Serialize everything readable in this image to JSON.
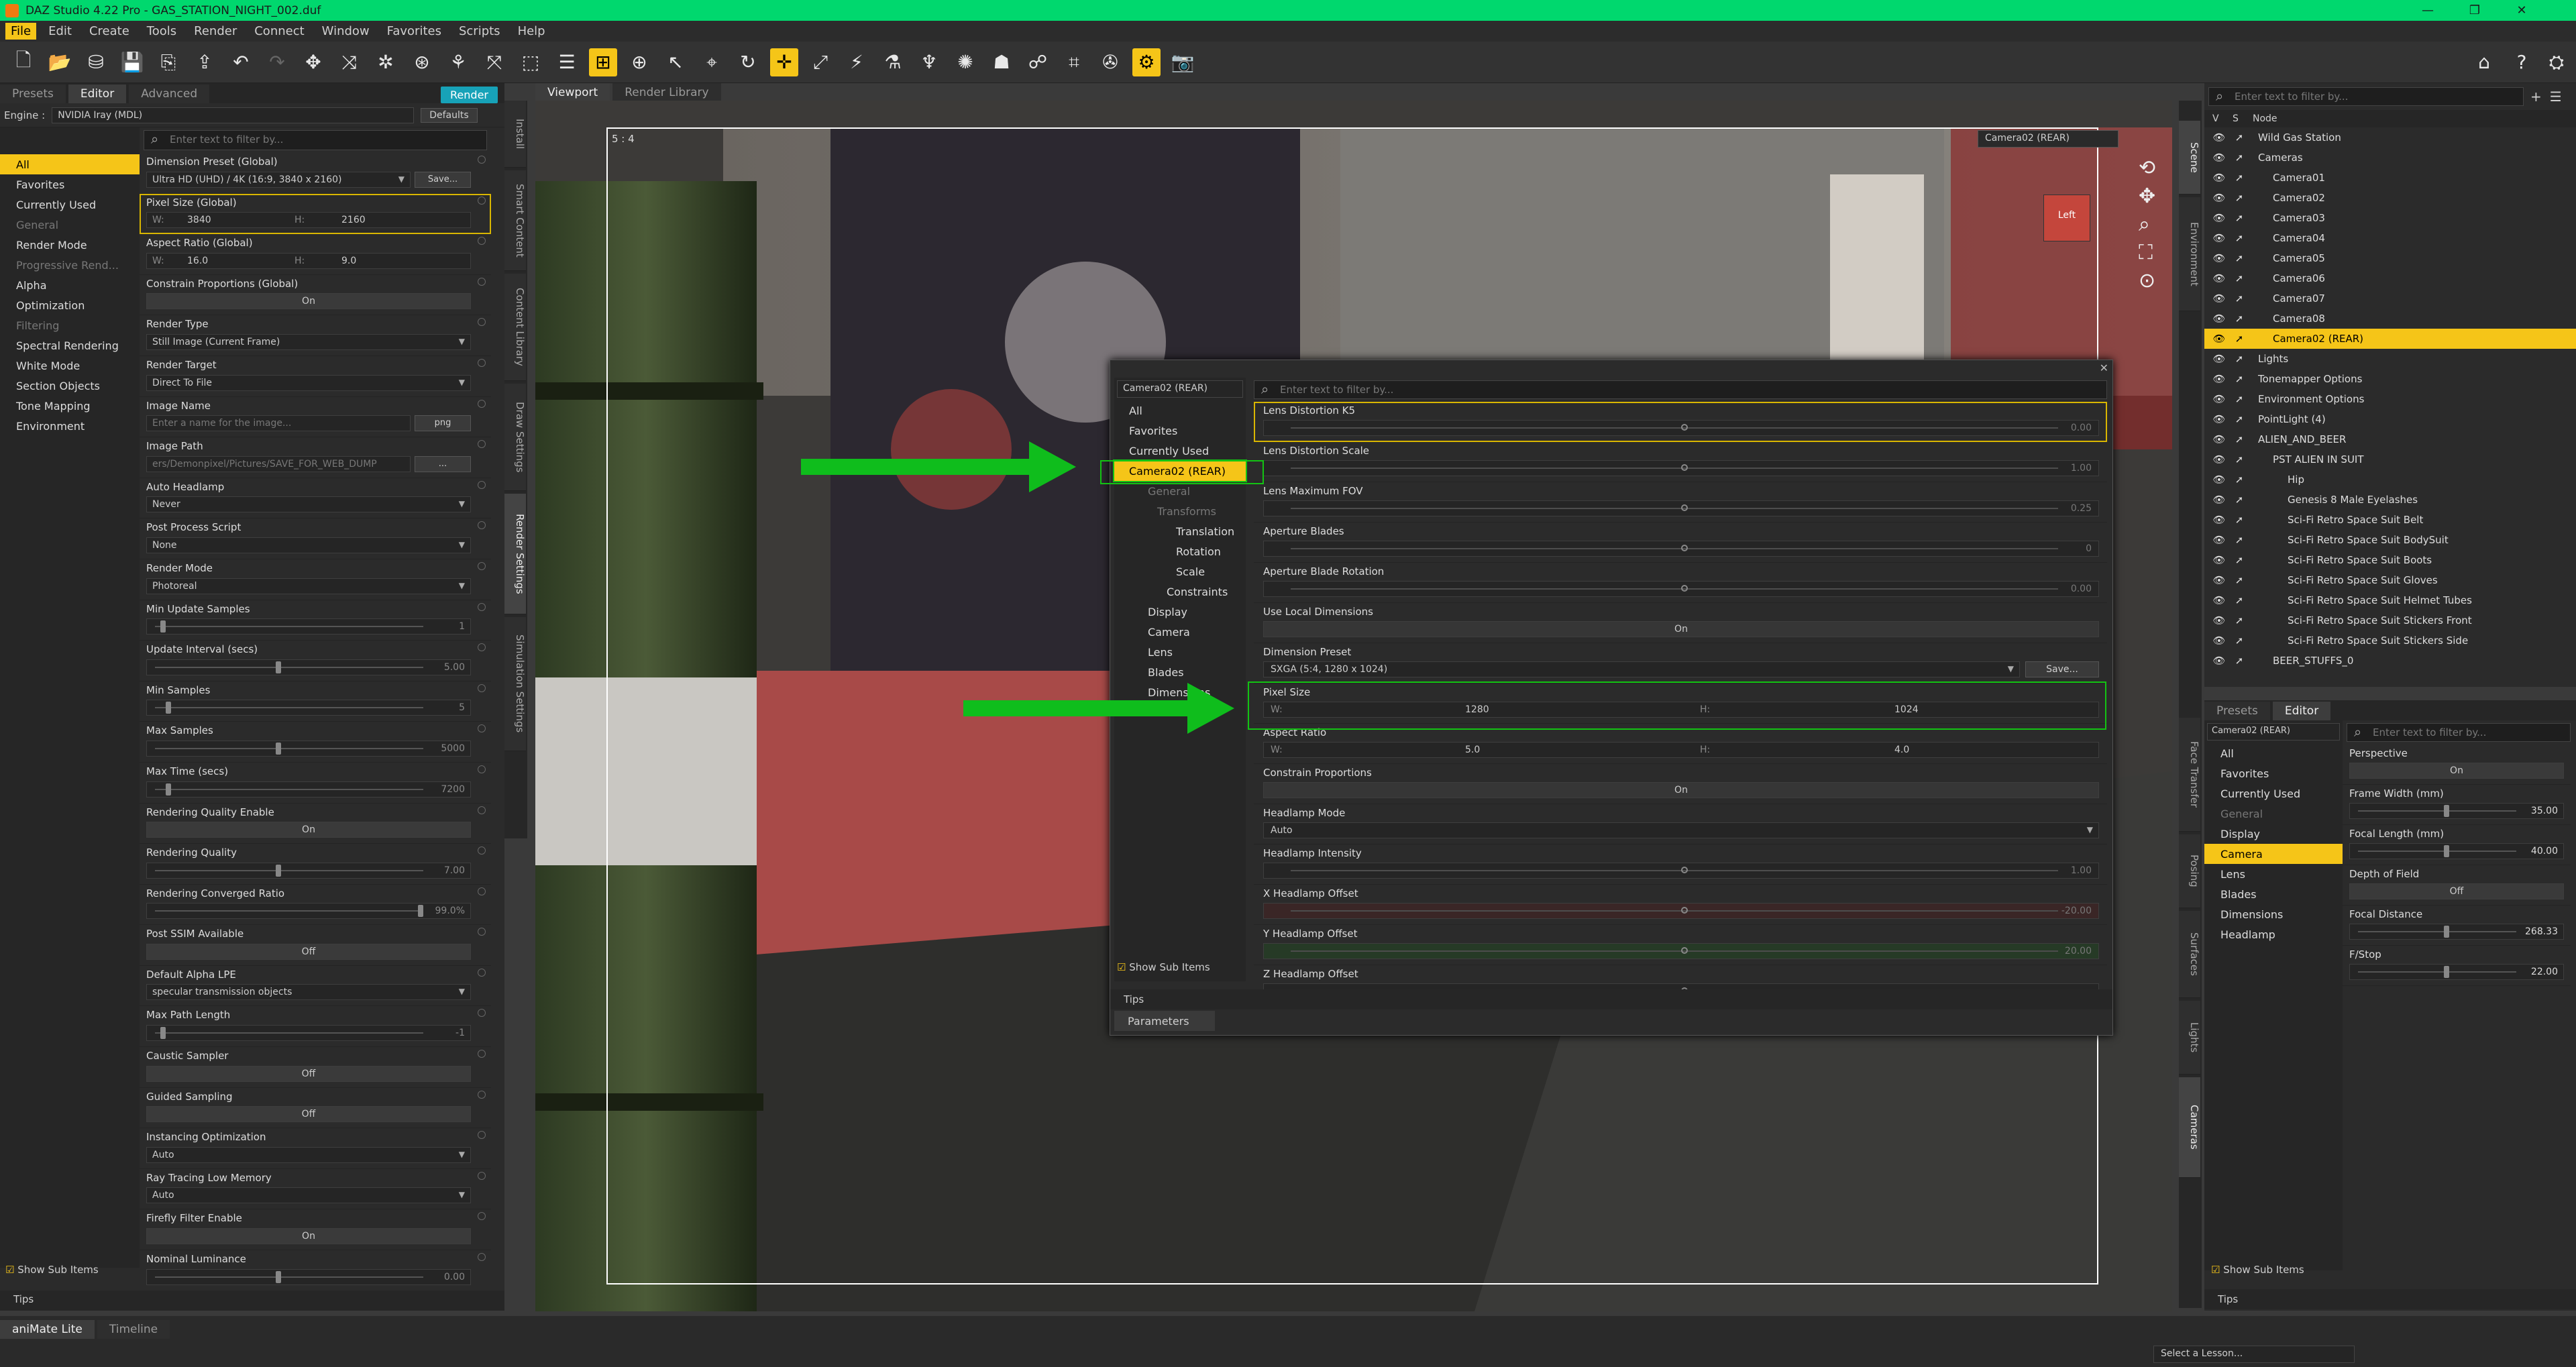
{
  "window": {
    "title": "DAZ Studio 4.22 Pro - GAS_STATION_NIGHT_002.duf",
    "min": "—",
    "max": "❐",
    "close": "✕"
  },
  "menus": [
    "File",
    "Edit",
    "Create",
    "Tools",
    "Render",
    "Connect",
    "Window",
    "Favorites",
    "Scripts",
    "Help"
  ],
  "left_panel": {
    "tabs": [
      "Presets",
      "Editor",
      "Advanced"
    ],
    "render_button": "Render",
    "engine_label": "Engine :",
    "engine_value": "NVIDIA Iray (MDL)",
    "defaults": "Defaults",
    "search_placeholder": "Enter text to filter by...",
    "nav": [
      "All",
      "Favorites",
      "Currently Used",
      "General",
      "Render Mode",
      "Progressive Rend...",
      "Alpha",
      "Optimization",
      "Filtering",
      "Spectral Rendering",
      "White Mode",
      "Section Objects",
      "Tone Mapping",
      "Environment"
    ],
    "props": [
      {
        "label": "Dimension Preset (Global)",
        "kind": "drop",
        "value": "Ultra HD (UHD) / 4K (16:9, 3840 x 2160)",
        "extra": "Save..."
      },
      {
        "label": "Pixel Size (Global)",
        "kind": "wh",
        "w": "3840",
        "h": "2160",
        "hi": true
      },
      {
        "label": "Aspect Ratio (Global)",
        "kind": "wh",
        "w": "16.0",
        "h": "9.0"
      },
      {
        "label": "Constrain Proportions (Global)",
        "kind": "btn",
        "value": "On"
      },
      {
        "label": "Render Type",
        "kind": "drop",
        "value": "Still Image (Current Frame)"
      },
      {
        "label": "Render Target",
        "kind": "drop",
        "value": "Direct To File"
      },
      {
        "label": "Image Name",
        "kind": "text",
        "value": "Enter a name for the image...",
        "extra": "png"
      },
      {
        "label": "Image Path",
        "kind": "text",
        "value": "ers/Demonpixel/Pictures/SAVE_FOR_WEB_DUMP",
        "extra": "..."
      },
      {
        "label": "Auto Headlamp",
        "kind": "drop",
        "value": "Never"
      },
      {
        "label": "Post Process Script",
        "kind": "drop",
        "value": "None"
      },
      {
        "label": "Render Mode",
        "kind": "drop",
        "value": "Photoreal"
      },
      {
        "label": "Min Update Samples",
        "kind": "slider",
        "value": "1",
        "pos": 0.02
      },
      {
        "label": "Update Interval (secs)",
        "kind": "slider",
        "value": "5.00",
        "pos": 0.45
      },
      {
        "label": "Min Samples",
        "kind": "slider",
        "value": "5",
        "pos": 0.04
      },
      {
        "label": "Max Samples",
        "kind": "slider",
        "value": "5000",
        "pos": 0.45
      },
      {
        "label": "Max Time (secs)",
        "kind": "slider",
        "value": "7200",
        "pos": 0.04
      },
      {
        "label": "Rendering Quality Enable",
        "kind": "btn",
        "value": "On"
      },
      {
        "label": "Rendering Quality",
        "kind": "slider",
        "value": "7.00",
        "pos": 0.45
      },
      {
        "label": "Rendering Converged Ratio",
        "kind": "slider",
        "value": "99.0%",
        "pos": 0.98
      },
      {
        "label": "Post SSIM Available",
        "kind": "btn",
        "value": "Off"
      },
      {
        "label": "Default Alpha LPE",
        "kind": "drop",
        "value": "specular transmission objects"
      },
      {
        "label": "Max Path Length",
        "kind": "slider",
        "value": "-1",
        "pos": 0.02
      },
      {
        "label": "Caustic Sampler",
        "kind": "btn",
        "value": "Off"
      },
      {
        "label": "Guided Sampling",
        "kind": "btn",
        "value": "Off"
      },
      {
        "label": "Instancing Optimization",
        "kind": "drop",
        "value": "Auto"
      },
      {
        "label": "Ray Tracing Low Memory",
        "kind": "drop",
        "value": "Auto"
      },
      {
        "label": "Firefly Filter Enable",
        "kind": "btn",
        "value": "On"
      },
      {
        "label": "Nominal Luminance",
        "kind": "slider",
        "value": "0.00",
        "pos": 0.45
      }
    ],
    "show_sub": "Show Sub Items",
    "tips": "Tips"
  },
  "left_vtabs": [
    "Install",
    "Smart Content",
    "Content Library",
    "Draw Settings",
    "Render Settings",
    "Simulation Settings"
  ],
  "viewport": {
    "tabs": [
      "Viewport",
      "Render Library"
    ],
    "ratio": "5 : 4",
    "camera": "Camera02 (REAR)",
    "cube": "Left"
  },
  "floating": {
    "camera": "Camera02 (REAR)",
    "search_placeholder": "Enter text to filter by...",
    "tree": [
      "All",
      "Favorites",
      "Currently Used",
      "Camera02 (REAR)",
      "General",
      "Transforms",
      "Translation",
      "Rotation",
      "Scale",
      "Constraints",
      "Display",
      "Camera",
      "Lens",
      "Blades",
      "Dimensions"
    ],
    "props": [
      {
        "label": "Lens Distortion K5",
        "kind": "slider",
        "value": "0.00"
      },
      {
        "label": "Lens Distortion Scale",
        "kind": "slider",
        "value": "1.00"
      },
      {
        "label": "Lens Maximum FOV",
        "kind": "slider",
        "value": "0.25"
      },
      {
        "label": "Aperture Blades",
        "kind": "slider",
        "value": "0"
      },
      {
        "label": "Aperture Blade Rotation",
        "kind": "slider",
        "value": "0.00"
      },
      {
        "label": "Use Local Dimensions",
        "kind": "btn",
        "value": "On"
      },
      {
        "label": "Dimension Preset",
        "kind": "drop",
        "value": "SXGA (5:4, 1280 x 1024)",
        "extra": "Save..."
      },
      {
        "label": "Pixel Size",
        "kind": "wh",
        "w": "1280",
        "h": "1024"
      },
      {
        "label": "Aspect Ratio",
        "kind": "wh",
        "w": "5.0",
        "h": "4.0"
      },
      {
        "label": "Constrain Proportions",
        "kind": "btn",
        "value": "On"
      },
      {
        "label": "Headlamp Mode",
        "kind": "drop",
        "value": "Auto"
      },
      {
        "label": "Headlamp Intensity",
        "kind": "slider",
        "value": "1.00"
      },
      {
        "label": "X Headlamp Offset",
        "kind": "slider",
        "value": "-20.00"
      },
      {
        "label": "Y Headlamp Offset",
        "kind": "slider",
        "value": "20.00"
      },
      {
        "label": "Z Headlamp Offset",
        "kind": "slider",
        "value": ""
      }
    ],
    "show_sub": "Show Sub Items",
    "tips": "Tips",
    "params": "Parameters"
  },
  "scene": {
    "search_placeholder": "Enter text to filter by...",
    "cols": [
      "V",
      "S",
      "Node"
    ],
    "rows": [
      {
        "label": "Wild Gas Station",
        "depth": 0
      },
      {
        "label": "Cameras",
        "depth": 0
      },
      {
        "label": "Camera01",
        "depth": 1
      },
      {
        "label": "Camera02",
        "depth": 1
      },
      {
        "label": "Camera03",
        "depth": 1
      },
      {
        "label": "Camera04",
        "depth": 1
      },
      {
        "label": "Camera05",
        "depth": 1
      },
      {
        "label": "Camera06",
        "depth": 1
      },
      {
        "label": "Camera07",
        "depth": 1
      },
      {
        "label": "Camera08",
        "depth": 1
      },
      {
        "label": "Camera02 (REAR)",
        "depth": 1,
        "sel": true
      },
      {
        "label": "Lights",
        "depth": 0
      },
      {
        "label": "Tonemapper Options",
        "depth": 0
      },
      {
        "label": "Environment Options",
        "depth": 0
      },
      {
        "label": "PointLight (4)",
        "depth": 0
      },
      {
        "label": "ALIEN_AND_BEER",
        "depth": 0
      },
      {
        "label": "PST ALIEN IN SUIT",
        "depth": 1
      },
      {
        "label": "Hip",
        "depth": 2
      },
      {
        "label": "Genesis 8 Male Eyelashes",
        "depth": 2
      },
      {
        "label": "Sci-Fi Retro Space Suit Belt",
        "depth": 2
      },
      {
        "label": "Sci-Fi Retro Space Suit BodySuit",
        "depth": 2
      },
      {
        "label": "Sci-Fi Retro Space Suit Boots",
        "depth": 2
      },
      {
        "label": "Sci-Fi Retro Space Suit Gloves",
        "depth": 2
      },
      {
        "label": "Sci-Fi Retro Space Suit Helmet Tubes",
        "depth": 2
      },
      {
        "label": "Sci-Fi Retro Space Suit Stickers Front",
        "depth": 2
      },
      {
        "label": "Sci-Fi Retro Space Suit Stickers Side",
        "depth": 2
      },
      {
        "label": "BEER_STUFFS_0",
        "depth": 1
      }
    ]
  },
  "right_vtabs_top": [
    "Scene",
    "Environment"
  ],
  "right_vtabs_bottom": [
    "Face Transfer",
    "Posing",
    "Surfaces",
    "Lights",
    "Cameras"
  ],
  "camera_panel": {
    "tabs": [
      "Presets",
      "Editor"
    ],
    "camera": "Camera02 (REAR)",
    "search_placeholder": "Enter text to filter by...",
    "nav": [
      "All",
      "Favorites",
      "Currently Used",
      "General",
      "Display",
      "Camera",
      "Lens",
      "Blades",
      "Dimensions",
      "Headlamp"
    ],
    "props": [
      {
        "label": "Perspective",
        "kind": "btn",
        "value": "On"
      },
      {
        "label": "Frame Width (mm)",
        "kind": "slider",
        "value": "35.00"
      },
      {
        "label": "Focal Length (mm)",
        "kind": "slider",
        "value": "40.00"
      },
      {
        "label": "Depth of Field",
        "kind": "btn",
        "value": "Off"
      },
      {
        "label": "Focal Distance",
        "kind": "slider",
        "value": "268.33"
      },
      {
        "label": "F/Stop",
        "kind": "slider",
        "value": "22.00"
      }
    ],
    "show_sub": "Show Sub Items",
    "tips": "Tips"
  },
  "bottom": {
    "tabs": [
      "aniMate Lite",
      "Timeline"
    ],
    "lesson": "Select a Lesson..."
  }
}
